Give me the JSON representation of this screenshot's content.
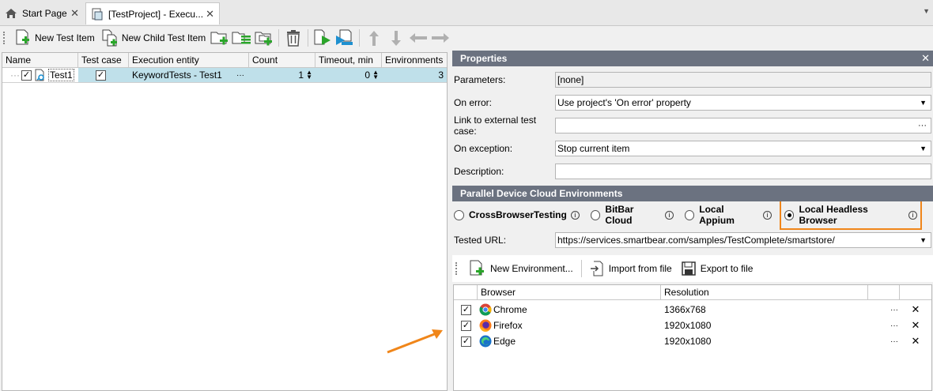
{
  "tabs": [
    {
      "label": "Start Page",
      "icon": "home-icon"
    },
    {
      "label": "[TestProject] - Execu...",
      "icon": "project-icon"
    }
  ],
  "toolbar": {
    "new_test_item": "New Test Item",
    "new_child_test_item": "New Child Test Item"
  },
  "test_grid": {
    "columns": [
      "Name",
      "Test case",
      "Execution entity",
      "Count",
      "Timeout, min",
      "Environments"
    ],
    "rows": [
      {
        "name": "Test1",
        "test_case": true,
        "execution_entity": "KeywordTests - Test1",
        "ellipsis": "···",
        "count": "1",
        "timeout": "0",
        "environments": "3"
      }
    ]
  },
  "properties": {
    "header": "Properties",
    "parameters_label": "Parameters:",
    "parameters_value": "[none]",
    "on_error_label": "On error:",
    "on_error_value": "Use project's 'On error' property",
    "link_label": "Link to external test case:",
    "link_value": "",
    "on_exception_label": "On exception:",
    "on_exception_value": "Stop current item",
    "description_label": "Description:",
    "description_value": ""
  },
  "cloud": {
    "header": "Parallel Device Cloud Environments",
    "options": [
      {
        "label": "CrossBrowserTesting",
        "selected": false
      },
      {
        "label": "BitBar Cloud",
        "selected": false
      },
      {
        "label": "Local Appium",
        "selected": false
      },
      {
        "label": "Local Headless Browser",
        "selected": true
      }
    ],
    "tested_url_label": "Tested URL:",
    "tested_url_value": "https://services.smartbear.com/samples/TestComplete/smartstore/",
    "highlight_color": "#f0861a"
  },
  "env_toolbar": {
    "new_environment": "New Environment...",
    "import": "Import from file",
    "export": "Export to file"
  },
  "env_grid": {
    "columns": [
      "Browser",
      "Resolution"
    ],
    "rows": [
      {
        "browser": "Chrome",
        "resolution": "1366x768",
        "icon": "chrome-icon"
      },
      {
        "browser": "Firefox",
        "resolution": "1920x1080",
        "icon": "firefox-icon"
      },
      {
        "browser": "Edge",
        "resolution": "1920x1080",
        "icon": "edge-icon"
      }
    ],
    "ellipsis": "···"
  }
}
